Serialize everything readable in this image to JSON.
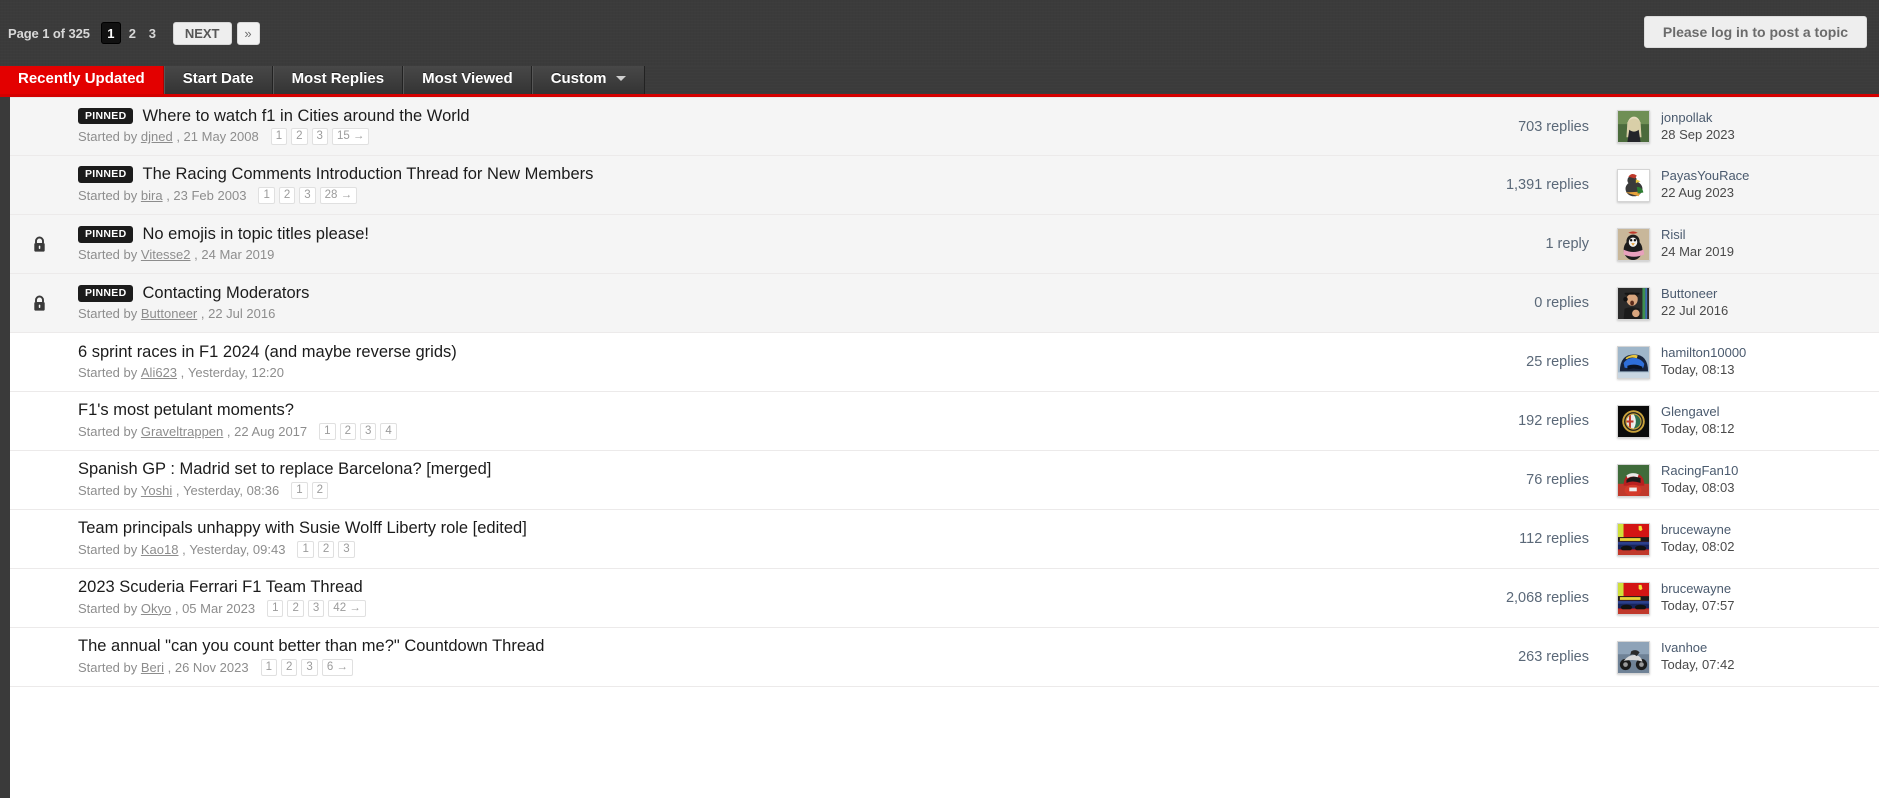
{
  "topbar": {
    "page_label_prefix": "Page",
    "page_current": "1",
    "page_of": "of",
    "page_total": "325",
    "pages": [
      "1",
      "2",
      "3"
    ],
    "next_label": "NEXT",
    "last_label": "»",
    "login_button": "Please log in to post a topic"
  },
  "tabs": [
    {
      "label": "Recently Updated",
      "active": true,
      "caret": false
    },
    {
      "label": "Start Date",
      "active": false,
      "caret": false
    },
    {
      "label": "Most Replies",
      "active": false,
      "caret": false
    },
    {
      "label": "Most Viewed",
      "active": false,
      "caret": false
    },
    {
      "label": "Custom",
      "active": false,
      "caret": true
    }
  ],
  "colors": {
    "accent_red": "#e30000",
    "topbar_dark": "#3b3b3b",
    "pinned_row_bg": "#f5f5f5",
    "link_blue": "#4a5a6e"
  },
  "labels": {
    "started_by": "Started by",
    "pinned": "PINNED",
    "comma": ","
  },
  "topics": [
    {
      "title": "Where to watch f1 in Cities around the World",
      "pinned": true,
      "locked": false,
      "author": "djned",
      "start_date": "21 May 2008",
      "pages": [
        "1",
        "2",
        "3",
        "15 →"
      ],
      "replies": "703 replies",
      "last_user": "jonpollak",
      "last_date": "28 Sep 2023",
      "avatar": "woman-photo"
    },
    {
      "title": "The Racing Comments Introduction Thread for New Members",
      "pinned": true,
      "locked": false,
      "author": "bira",
      "start_date": "23 Feb 2003",
      "pages": [
        "1",
        "2",
        "3",
        "28 →"
      ],
      "replies": "1,391 replies",
      "last_user": "PayasYouRace",
      "last_date": "22 Aug 2023",
      "avatar": "cartoon-bird"
    },
    {
      "title": "No emojis in topic titles please!",
      "pinned": true,
      "locked": true,
      "author": "Vitesse2",
      "start_date": "24 Mar 2019",
      "pages": [],
      "replies": "1 reply",
      "last_user": "Risil",
      "last_date": "24 Mar 2019",
      "avatar": "penguin-scarf"
    },
    {
      "title": "Contacting Moderators",
      "pinned": true,
      "locked": true,
      "author": "Buttoneer",
      "start_date": "22 Jul 2016",
      "pages": [],
      "replies": "0 replies",
      "last_user": "Buttoneer",
      "last_date": "22 Jul 2016",
      "avatar": "man-headset"
    },
    {
      "title": "6 sprint races in F1 2024 (and maybe reverse grids)",
      "pinned": false,
      "locked": false,
      "author": "Ali623",
      "start_date": "Yesterday, 12:20",
      "pages": [],
      "replies": "25 replies",
      "last_user": "hamilton10000",
      "last_date": "Today, 08:13",
      "avatar": "racing-helmet-blue"
    },
    {
      "title": "F1's most petulant moments?",
      "pinned": false,
      "locked": false,
      "author": "Graveltrappen",
      "start_date": "22 Aug 2017",
      "pages": [
        "1",
        "2",
        "3",
        "4"
      ],
      "replies": "192 replies",
      "last_user": "Glengavel",
      "last_date": "Today, 08:12",
      "avatar": "alfa-romeo-badge"
    },
    {
      "title": "Spanish GP : Madrid set to replace Barcelona? [merged]",
      "pinned": false,
      "locked": false,
      "author": "Yoshi",
      "start_date": "Yesterday, 08:36",
      "pages": [
        "1",
        "2"
      ],
      "replies": "76 replies",
      "last_user": "RacingFan10",
      "last_date": "Today, 08:03",
      "avatar": "driver-red-suit"
    },
    {
      "title": "Team principals unhappy with Susie Wolff Liberty role [edited]",
      "pinned": false,
      "locked": false,
      "author": "Kao18",
      "start_date": "Yesterday, 09:43",
      "pages": [
        "1",
        "2",
        "3"
      ],
      "replies": "112 replies",
      "last_user": "brucewayne",
      "last_date": "Today, 08:02",
      "avatar": "ferrari-garage"
    },
    {
      "title": "2023 Scuderia Ferrari F1 Team Thread",
      "pinned": false,
      "locked": false,
      "author": "Okyo",
      "start_date": "05 Mar 2023",
      "pages": [
        "1",
        "2",
        "3",
        "42 →"
      ],
      "replies": "2,068 replies",
      "last_user": "brucewayne",
      "last_date": "Today, 07:57",
      "avatar": "ferrari-garage"
    },
    {
      "title": "The annual \"can you count better than me?\" Countdown Thread",
      "pinned": false,
      "locked": false,
      "author": "Beri",
      "start_date": "26 Nov 2023",
      "pages": [
        "1",
        "2",
        "3",
        "6 →"
      ],
      "replies": "263 replies",
      "last_user": "Ivanhoe",
      "last_date": "Today, 07:42",
      "avatar": "motorbike"
    }
  ]
}
